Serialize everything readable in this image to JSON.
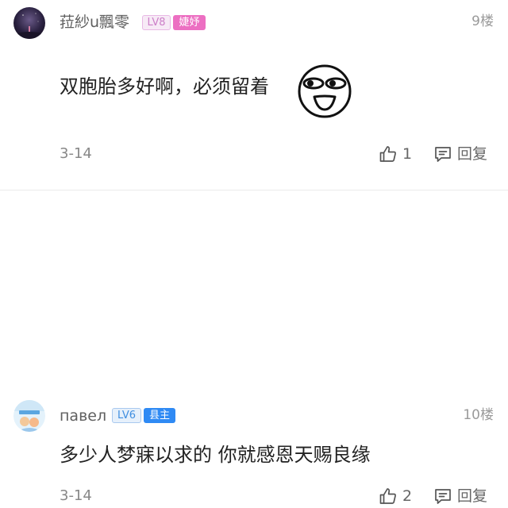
{
  "comments": [
    {
      "username": "菈紗u飄零",
      "level": "LV8",
      "tag": "婕妤",
      "floor": "9楼",
      "text": "双胞胎多好啊，必须留着",
      "date": "3-14",
      "likes": "1",
      "reply_label": "回复",
      "has_emoji": true,
      "level_color": "#cc7fc8",
      "tag_color": "#ec6fc2"
    },
    {
      "username": "павел",
      "level": "LV6",
      "tag": "县主",
      "floor": "10楼",
      "text": "多少人梦寐以求的 你就感恩天赐良缘",
      "date": "3-14",
      "likes": "2",
      "reply_label": "回复",
      "has_emoji": false,
      "level_color": "#3f8ee0",
      "tag_color": "#2f8af4"
    }
  ],
  "icons": {
    "like": "thumbs-up-icon",
    "reply": "speech-bubble-icon",
    "emoji": "smirk-face-emoji-icon"
  }
}
